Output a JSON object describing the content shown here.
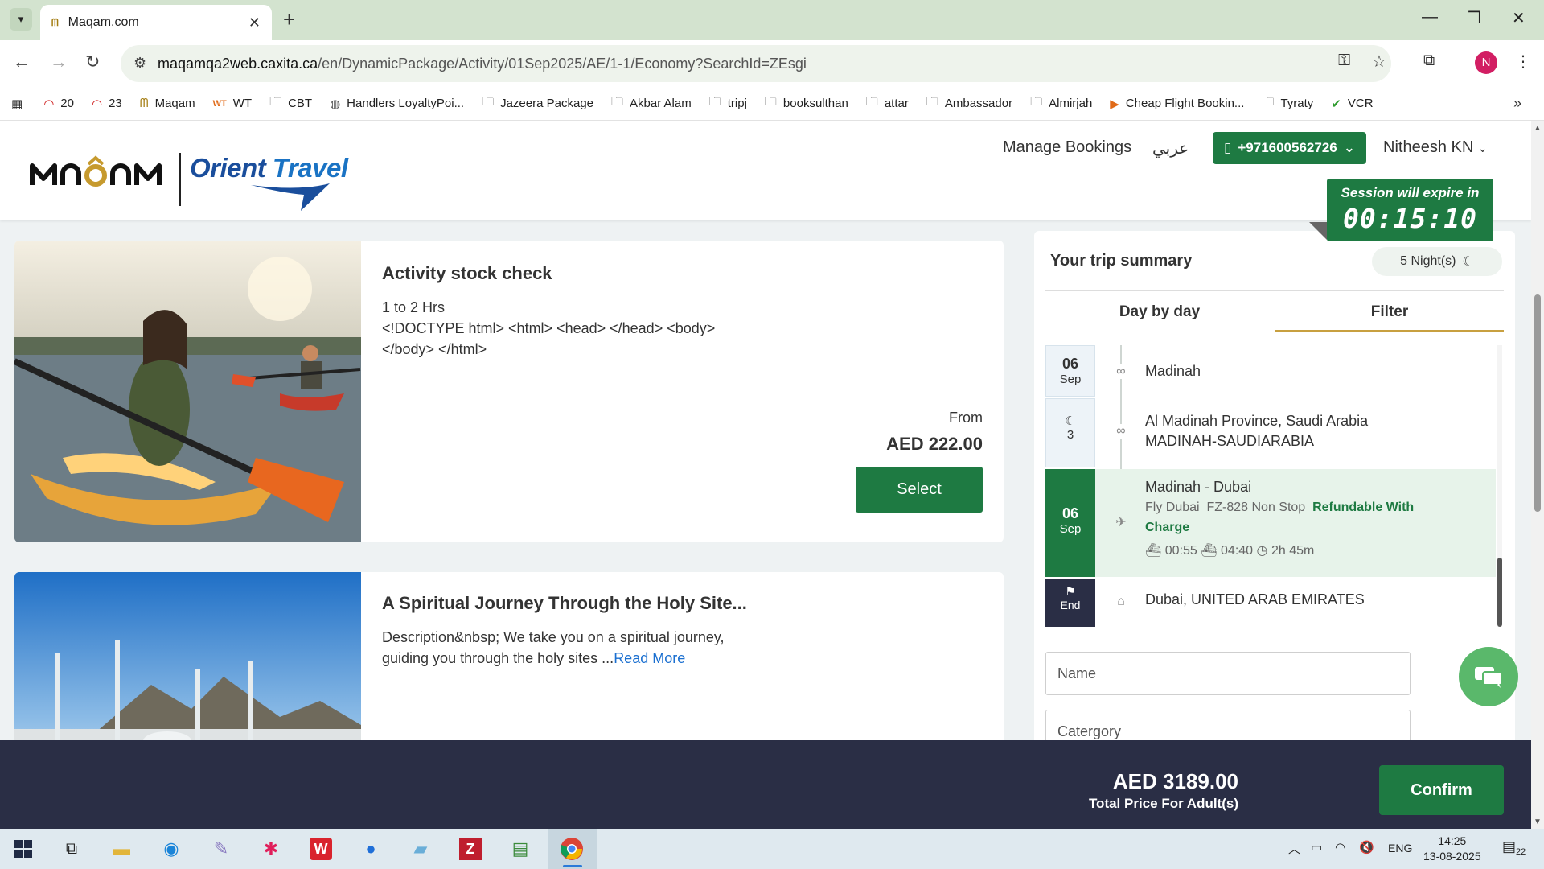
{
  "browser": {
    "tab_title": "Maqam.com",
    "url_host": "maqamqa2web.caxita.ca",
    "url_path": "/en/DynamicPackage/Activity/01Sep2025/AE/1-1/Economy?SearchId=ZEsgi",
    "profile_initial": "N",
    "bookmarks": [
      {
        "label": "20",
        "icon": "gauge-icon"
      },
      {
        "label": "23",
        "icon": "gauge-icon"
      },
      {
        "label": "Maqam",
        "icon": "maqam-favicon"
      },
      {
        "label": "WT",
        "icon": "wt-favicon"
      },
      {
        "label": "CBT",
        "icon": "folder-icon"
      },
      {
        "label": "Handlers LoyaltyPoi...",
        "icon": "globe-icon"
      },
      {
        "label": "Jazeera Package",
        "icon": "folder-icon"
      },
      {
        "label": "Akbar Alam",
        "icon": "folder-icon"
      },
      {
        "label": "tripj",
        "icon": "folder-icon"
      },
      {
        "label": "booksulthan",
        "icon": "folder-icon"
      },
      {
        "label": "attar",
        "icon": "folder-icon"
      },
      {
        "label": "Ambassador",
        "icon": "folder-icon"
      },
      {
        "label": "Almirjah",
        "icon": "folder-icon"
      },
      {
        "label": "Cheap Flight Bookin...",
        "icon": "flight-favicon"
      },
      {
        "label": "Tyraty",
        "icon": "folder-icon"
      },
      {
        "label": "VCR",
        "icon": "vcr-favicon"
      }
    ]
  },
  "header": {
    "manage_bookings": "Manage Bookings",
    "language": "عربي",
    "phone": "+971600562726",
    "user_name": "Nitheesh KN",
    "logo_text": "MAQAM",
    "partner_logo_text_1": "Orient",
    "partner_logo_text_2": "Travel"
  },
  "session": {
    "label": "Session will expire in",
    "time": "00:15:10"
  },
  "activities": [
    {
      "title": "Activity stock check",
      "duration": "1 to 2 Hrs",
      "description_line1": "<!DOCTYPE html> <html> <head> </head> <body>",
      "description_line2": "</body> </html>",
      "from_label": "From",
      "price": "AED 222.00",
      "select_label": "Select"
    },
    {
      "title": "A Spiritual Journey Through the Holy Site...",
      "description_line1": "Description&nbsp; We take you on a spiritual journey,",
      "description_line2": "guiding you through the holy sites ...",
      "read_more": "Read More"
    }
  ],
  "trip_summary": {
    "title": "Your trip summary",
    "nights": "5 Night(s)",
    "tabs": [
      "Day by day",
      "Filter"
    ],
    "active_tab": "Filter",
    "timeline": [
      {
        "day": "06",
        "month": "Sep",
        "icon": "binoculars-icon",
        "text": "Madinah"
      },
      {
        "nights": "3",
        "icon": "binoculars-icon",
        "line1": "Al Madinah Province, Saudi Arabia",
        "line2": "MADINAH-SAUDIARABIA"
      },
      {
        "day": "06",
        "month": "Sep",
        "icon": "plane-icon",
        "route": "Madinah - Dubai",
        "airline": "Fly Dubai",
        "flight": "FZ-828 Non Stop",
        "refund_1": "Refundable With",
        "refund_2": "Charge",
        "depart": "00:55",
        "arrive": "04:40",
        "duration": "2h 45m"
      },
      {
        "end_label": "End",
        "icon": "home-icon",
        "text": "Dubai, UNITED ARAB EMIRATES"
      }
    ],
    "filter_name_placeholder": "Name",
    "filter_category_placeholder": "Catergory"
  },
  "footer": {
    "total_amount": "AED 3189.00",
    "total_label": "Total Price For Adult(s)",
    "confirm_label": "Confirm"
  },
  "taskbar": {
    "language": "ENG",
    "time": "14:25",
    "date": "13-08-2025",
    "notifications": "22"
  },
  "colors": {
    "brand_green": "#1e7a42",
    "dark_navy": "#2a2e45",
    "link_blue": "#1a6fd0",
    "gold": "#c69a2e"
  }
}
